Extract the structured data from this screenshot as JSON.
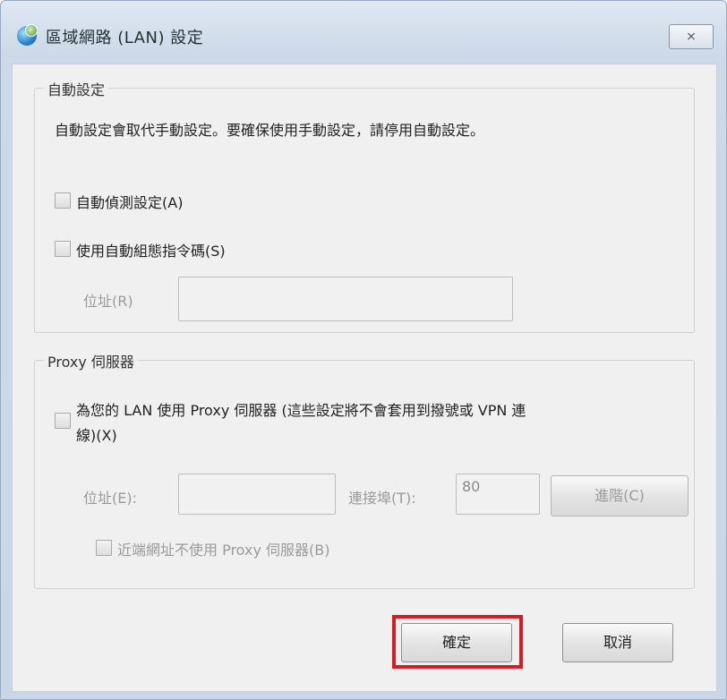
{
  "window": {
    "title": "區域網路 (LAN) 設定",
    "close_label": "⨯"
  },
  "auto_config": {
    "group_title": "自動設定",
    "description": "自動設定會取代手動設定。要確保使用手動設定，請停用自動設定。",
    "auto_detect_label": "自動偵測設定(A)",
    "use_script_label": "使用自動組態指令碼(S)",
    "address_label": "位址(R)",
    "address_value": ""
  },
  "proxy": {
    "group_title": "Proxy 伺服器",
    "use_proxy_label_line1": "為您的 LAN 使用 Proxy 伺服器 (這些設定將不會套用到撥號或 VPN 連",
    "use_proxy_label_line2": "線)(X)",
    "address_label": "位址(E):",
    "address_value": "",
    "port_label": "連接埠(T):",
    "port_value": "80",
    "advanced_label": "進階(C)",
    "bypass_label": "近端網址不使用 Proxy 伺服器(B)"
  },
  "buttons": {
    "ok_label": "確定",
    "cancel_label": "取消"
  },
  "colors": {
    "highlight": "#d61b22"
  }
}
